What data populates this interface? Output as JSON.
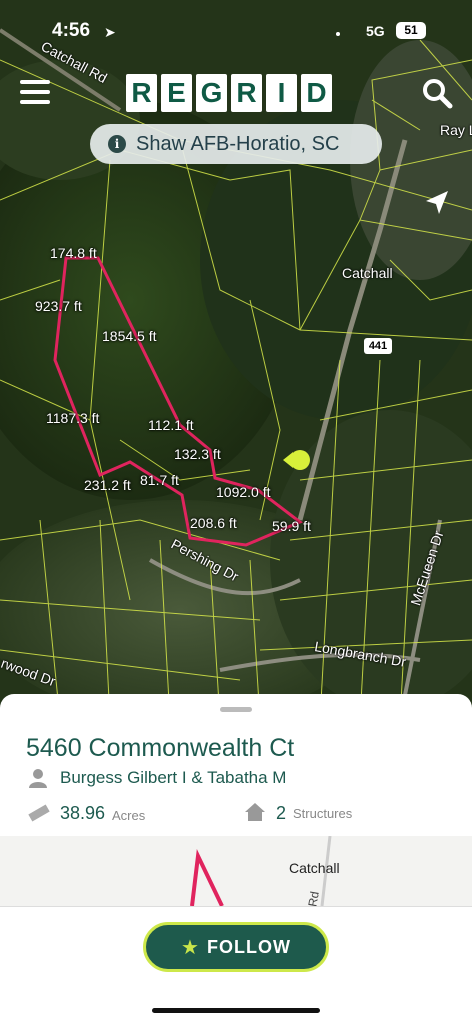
{
  "status_bar": {
    "time": "4:56",
    "network": "5G",
    "battery": "51"
  },
  "header": {
    "logo_letters": [
      "R",
      "E",
      "G",
      "R",
      "I",
      "D"
    ],
    "location": "Shaw AFB-Horatio, SC"
  },
  "map": {
    "labels": {
      "catchall_rd": "Catchall Rd",
      "ray": "Ray L",
      "catchall": "Catchall",
      "highway": "441",
      "pershing": "Pershing Dr",
      "mceueen": "McEueen Dr",
      "longbranch": "Longbranch Dr",
      "wood": "rwood Dr"
    },
    "measurements": [
      "174.8 ft",
      "923.7 ft",
      "1854.5 ft",
      "1187.3 ft",
      "112.1 ft",
      "132.3 ft",
      "231.2 ft",
      "81.7 ft",
      "1092.0 ft",
      "208.6 ft",
      "59.9 ft"
    ]
  },
  "parcel": {
    "address": "5460 Commonwealth Ct",
    "owner": "Burgess Gilbert I & Tabatha M",
    "acres": "38.96",
    "acres_unit": "Acres",
    "structures": "2",
    "structures_unit": "Structures"
  },
  "minimap": {
    "label": "Catchall",
    "road": "Rd"
  },
  "follow": {
    "label": "FOLLOW"
  },
  "colors": {
    "brand": "#1e5a4c",
    "accent": "#cde84a",
    "parcel_line": "#e0245e",
    "parcel_grid": "#d7e84a"
  }
}
